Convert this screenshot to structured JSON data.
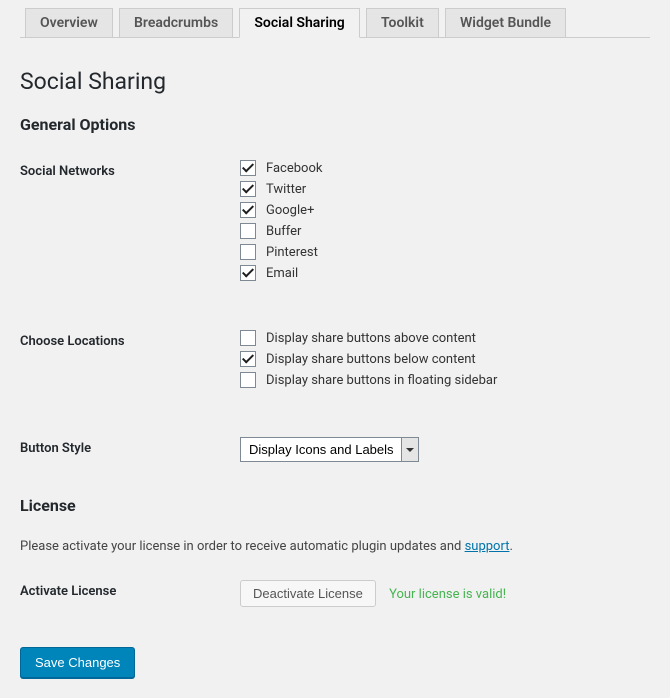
{
  "tabs": {
    "items": [
      {
        "label": "Overview",
        "active": false
      },
      {
        "label": "Breadcrumbs",
        "active": false
      },
      {
        "label": "Social Sharing",
        "active": true
      },
      {
        "label": "Toolkit",
        "active": false
      },
      {
        "label": "Widget Bundle",
        "active": false
      }
    ]
  },
  "page": {
    "title": "Social Sharing"
  },
  "sections": {
    "general": {
      "title": "General Options"
    },
    "license": {
      "title": "License"
    }
  },
  "fields": {
    "social_networks": {
      "label": "Social Networks",
      "options": [
        {
          "label": "Facebook",
          "checked": true
        },
        {
          "label": "Twitter",
          "checked": true
        },
        {
          "label": "Google+",
          "checked": true
        },
        {
          "label": "Buffer",
          "checked": false
        },
        {
          "label": "Pinterest",
          "checked": false
        },
        {
          "label": "Email",
          "checked": true
        }
      ]
    },
    "locations": {
      "label": "Choose Locations",
      "options": [
        {
          "label": "Display share buttons above content",
          "checked": false
        },
        {
          "label": "Display share buttons below content",
          "checked": true
        },
        {
          "label": "Display share buttons in floating sidebar",
          "checked": false
        }
      ]
    },
    "button_style": {
      "label": "Button Style",
      "selected": "Display Icons and Labels"
    },
    "activate_license": {
      "label": "Activate License",
      "button": "Deactivate License",
      "status": "Your license is valid!"
    }
  },
  "license_text": {
    "prefix": "Please activate your license in order to receive automatic plugin updates and ",
    "link": "support",
    "suffix": "."
  },
  "submit": {
    "label": "Save Changes"
  }
}
